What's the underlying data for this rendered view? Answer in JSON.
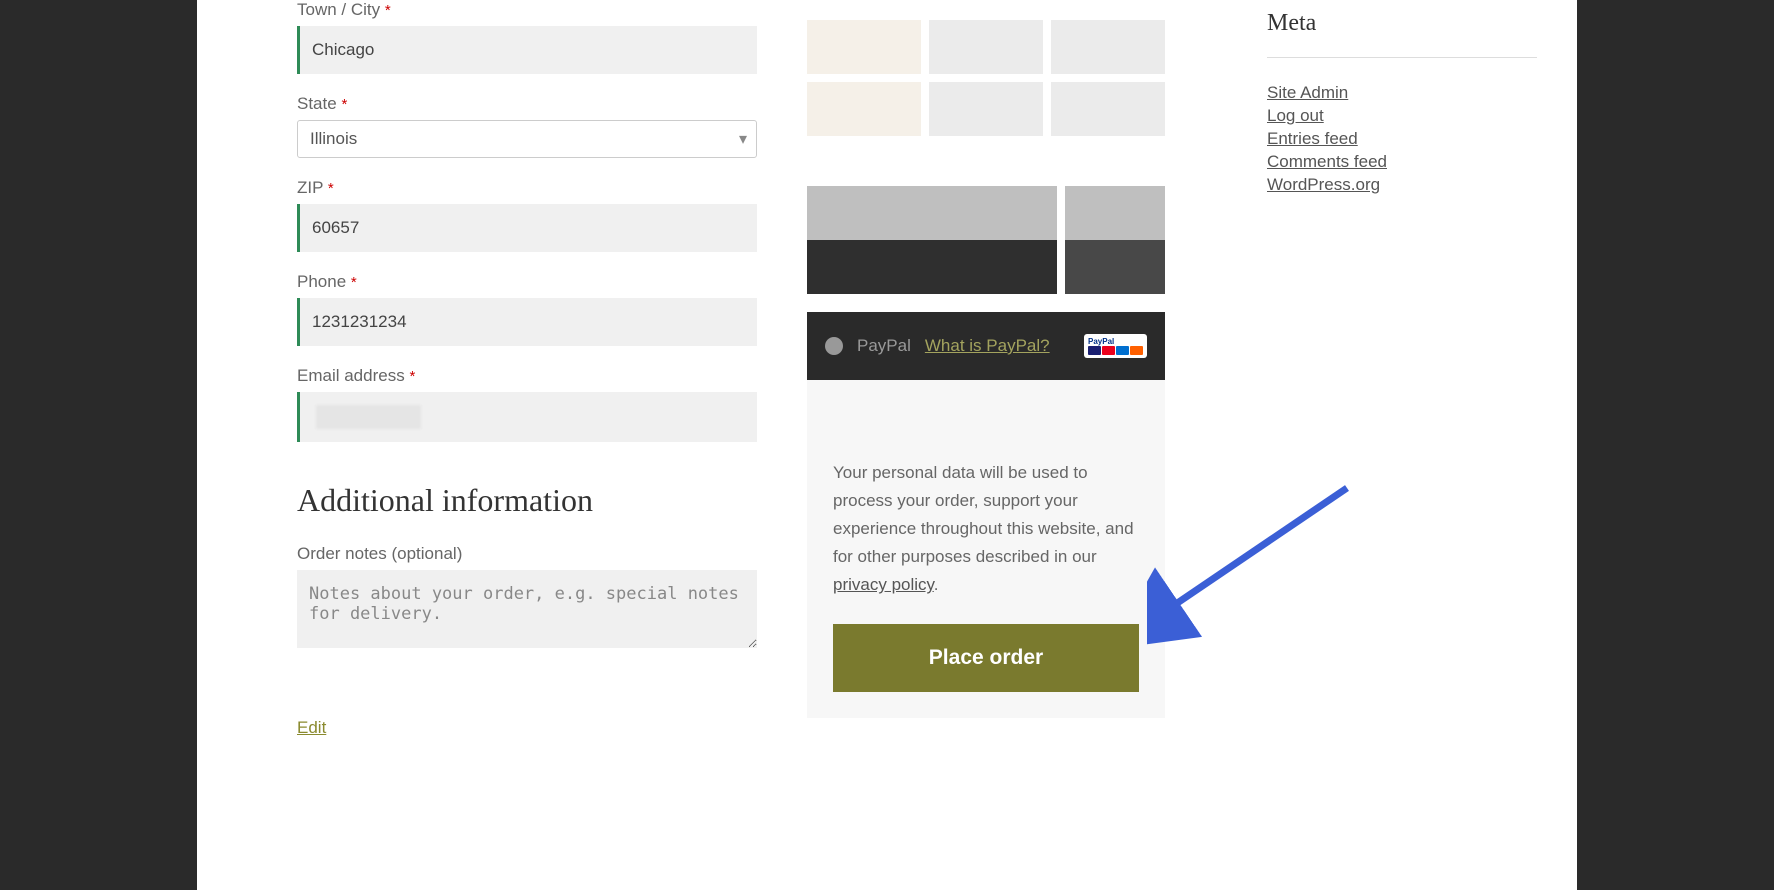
{
  "billing": {
    "city_label": "Town / City",
    "city_value": "Chicago",
    "state_label": "State",
    "state_value": "Illinois",
    "zip_label": "ZIP",
    "zip_value": "60657",
    "phone_label": "Phone",
    "phone_value": "1231231234",
    "email_label": "Email address",
    "email_value": ""
  },
  "additional": {
    "heading": "Additional information",
    "notes_label": "Order notes (optional)",
    "notes_placeholder": "Notes about your order, e.g. special notes for delivery."
  },
  "edit_link": "Edit",
  "payment": {
    "paypal_label": "PayPal",
    "paypal_help_link": "What is PayPal?"
  },
  "privacy": {
    "text": "Your personal data will be used to process your order, support your experience throughout this website, and for other purposes described in our ",
    "link_text": "privacy policy"
  },
  "place_order_label": "Place order",
  "sidebar": {
    "heading": "Meta",
    "links": [
      "Site Admin",
      "Log out",
      "Entries feed",
      "Comments feed",
      "WordPress.org"
    ]
  },
  "required_marker": "*"
}
